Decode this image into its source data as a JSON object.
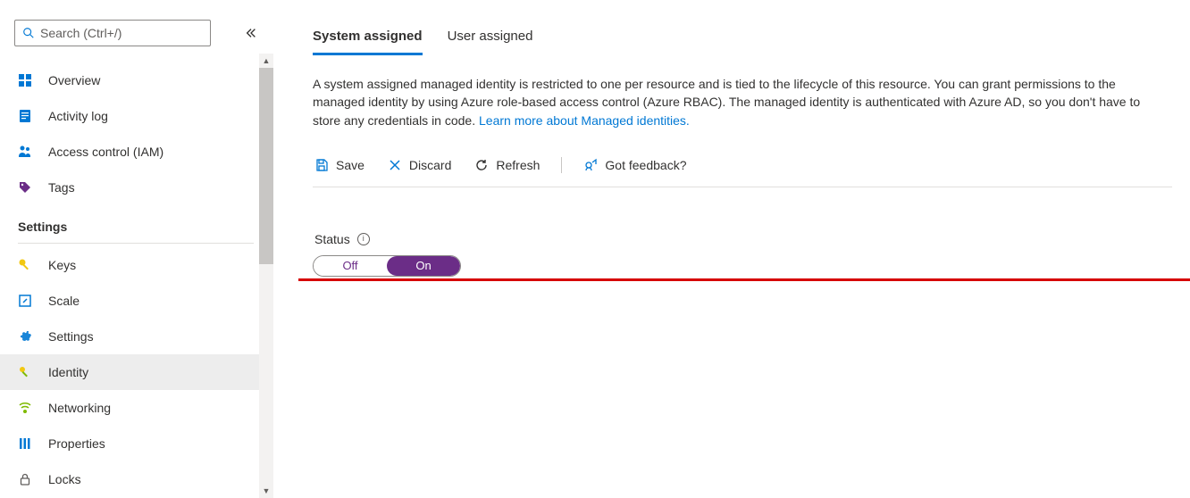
{
  "search": {
    "placeholder": "Search (Ctrl+/)"
  },
  "sidebar": {
    "items": [
      {
        "label": "Overview"
      },
      {
        "label": "Activity log"
      },
      {
        "label": "Access control (IAM)"
      },
      {
        "label": "Tags"
      }
    ],
    "settings_heading": "Settings",
    "settings": [
      {
        "label": "Keys"
      },
      {
        "label": "Scale"
      },
      {
        "label": "Settings"
      },
      {
        "label": "Identity"
      },
      {
        "label": "Networking"
      },
      {
        "label": "Properties"
      },
      {
        "label": "Locks"
      }
    ]
  },
  "tabs": {
    "system": "System assigned",
    "user": "User assigned"
  },
  "description_text": "A system assigned managed identity is restricted to one per resource and is tied to the lifecycle of this resource. You can grant permissions to the managed identity by using Azure role-based access control (Azure RBAC). The managed identity is authenticated with Azure AD, so you don't have to store any credentials in code. ",
  "description_link": "Learn more about Managed identities.",
  "toolbar": {
    "save": "Save",
    "discard": "Discard",
    "refresh": "Refresh",
    "feedback": "Got feedback?"
  },
  "status": {
    "label": "Status",
    "off": "Off",
    "on": "On"
  }
}
